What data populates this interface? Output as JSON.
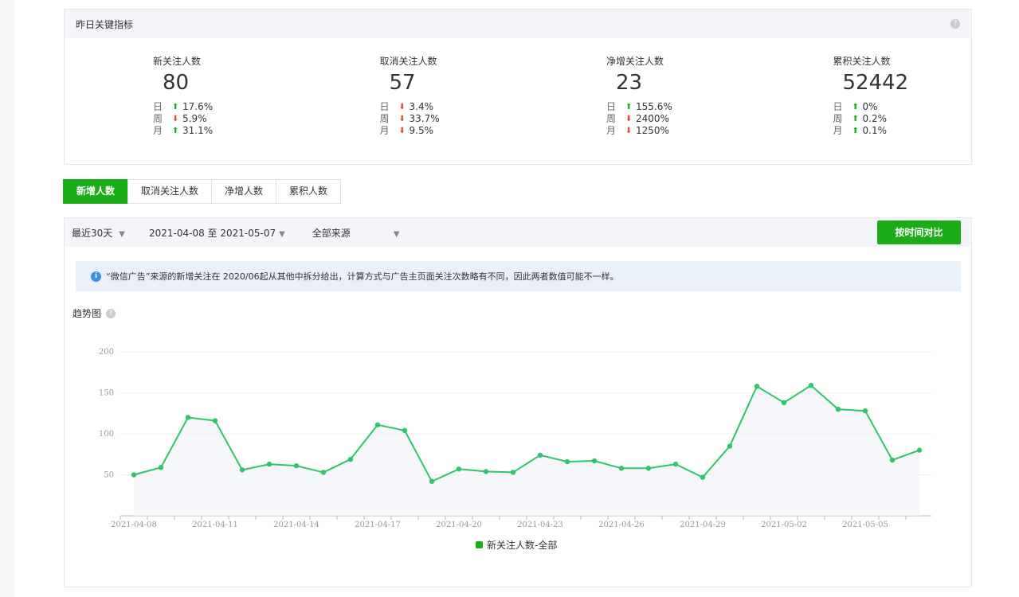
{
  "kpi": {
    "title": "昨日关键指标",
    "metrics": [
      {
        "label": "新关注人数",
        "value": "80",
        "rows": [
          {
            "k": "日",
            "dir": "up",
            "v": "17.6%"
          },
          {
            "k": "周",
            "dir": "down",
            "v": "5.9%"
          },
          {
            "k": "月",
            "dir": "up",
            "v": "31.1%"
          }
        ]
      },
      {
        "label": "取消关注人数",
        "value": "57",
        "rows": [
          {
            "k": "日",
            "dir": "down",
            "v": "3.4%"
          },
          {
            "k": "周",
            "dir": "down",
            "v": "33.7%"
          },
          {
            "k": "月",
            "dir": "down",
            "v": "9.5%"
          }
        ]
      },
      {
        "label": "净增关注人数",
        "value": "23",
        "rows": [
          {
            "k": "日",
            "dir": "up",
            "v": "155.6%"
          },
          {
            "k": "周",
            "dir": "down",
            "v": "2400%"
          },
          {
            "k": "月",
            "dir": "down",
            "v": "1250%"
          }
        ]
      },
      {
        "label": "累积关注人数",
        "value": "52442",
        "rows": [
          {
            "k": "日",
            "dir": "up",
            "v": "0%"
          },
          {
            "k": "周",
            "dir": "up",
            "v": "0.2%"
          },
          {
            "k": "月",
            "dir": "up",
            "v": "0.1%"
          }
        ]
      }
    ]
  },
  "tabs": [
    "新增人数",
    "取消关注人数",
    "净增人数",
    "累积人数"
  ],
  "filter": {
    "range": "最近30天",
    "dates": "2021-04-08 至 2021-05-07",
    "source": "全部来源",
    "compare_button": "按时间对比"
  },
  "notice": "“微信广告”来源的新增关注在 2020/06起从其他中拆分给出，计算方式与广告主页面关注次数略有不同，因此两者数值可能不一样。",
  "trend_title": "趋势图",
  "chart_data": {
    "type": "line",
    "x": [
      "2021-04-08",
      "2021-04-09",
      "2021-04-10",
      "2021-04-11",
      "2021-04-12",
      "2021-04-13",
      "2021-04-14",
      "2021-04-15",
      "2021-04-16",
      "2021-04-17",
      "2021-04-18",
      "2021-04-19",
      "2021-04-20",
      "2021-04-21",
      "2021-04-22",
      "2021-04-23",
      "2021-04-24",
      "2021-04-25",
      "2021-04-26",
      "2021-04-27",
      "2021-04-28",
      "2021-04-29",
      "2021-04-30",
      "2021-05-01",
      "2021-05-02",
      "2021-05-03",
      "2021-05-04",
      "2021-05-05",
      "2021-05-06",
      "2021-05-07"
    ],
    "tick_labels": [
      "2021-04-08",
      "2021-04-11",
      "2021-04-14",
      "2021-04-17",
      "2021-04-20",
      "2021-04-23",
      "2021-04-26",
      "2021-04-29",
      "2021-05-02",
      "2021-05-05"
    ],
    "series": [
      {
        "name": "新关注人数-全部",
        "values": [
          50,
          59,
          120,
          116,
          56,
          63,
          61,
          53,
          69,
          111,
          104,
          42,
          57,
          54,
          53,
          74,
          66,
          67,
          58,
          58,
          63,
          47,
          85,
          158,
          138,
          159,
          130,
          128,
          68,
          80
        ]
      }
    ],
    "yticks": [
      50,
      100,
      150,
      200
    ],
    "ylim": [
      0,
      200
    ],
    "grid": true,
    "legend": "bottom"
  },
  "colors": {
    "accent": "#1aad19",
    "line": "#2ec56c",
    "up": "#1aad19",
    "down": "#e64340"
  }
}
